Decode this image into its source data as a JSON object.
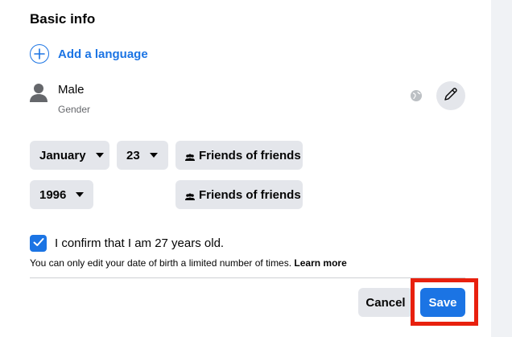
{
  "section": {
    "title": "Basic info"
  },
  "add_language": {
    "label": "Add a language",
    "icon": "plus-circle-icon"
  },
  "gender": {
    "value": "Male",
    "label": "Gender",
    "icon": "person-icon",
    "audience_icon": "globe-icon",
    "edit_icon": "pencil-icon"
  },
  "birthday": {
    "month": "January",
    "day": "23",
    "year": "1996",
    "month_day_privacy": "Friends of friends",
    "year_privacy": "Friends of friends",
    "privacy_icon": "friends-icon"
  },
  "confirm": {
    "checked": true,
    "label": "I confirm that I am 27 years old.",
    "note": "You can only edit your date of birth a limited number of times. ",
    "learn_more": "Learn more"
  },
  "actions": {
    "cancel": "Cancel",
    "save": "Save"
  },
  "colors": {
    "accent": "#1b74e4",
    "highlight": "#e8200e",
    "button_bg": "#e4e6eb"
  }
}
